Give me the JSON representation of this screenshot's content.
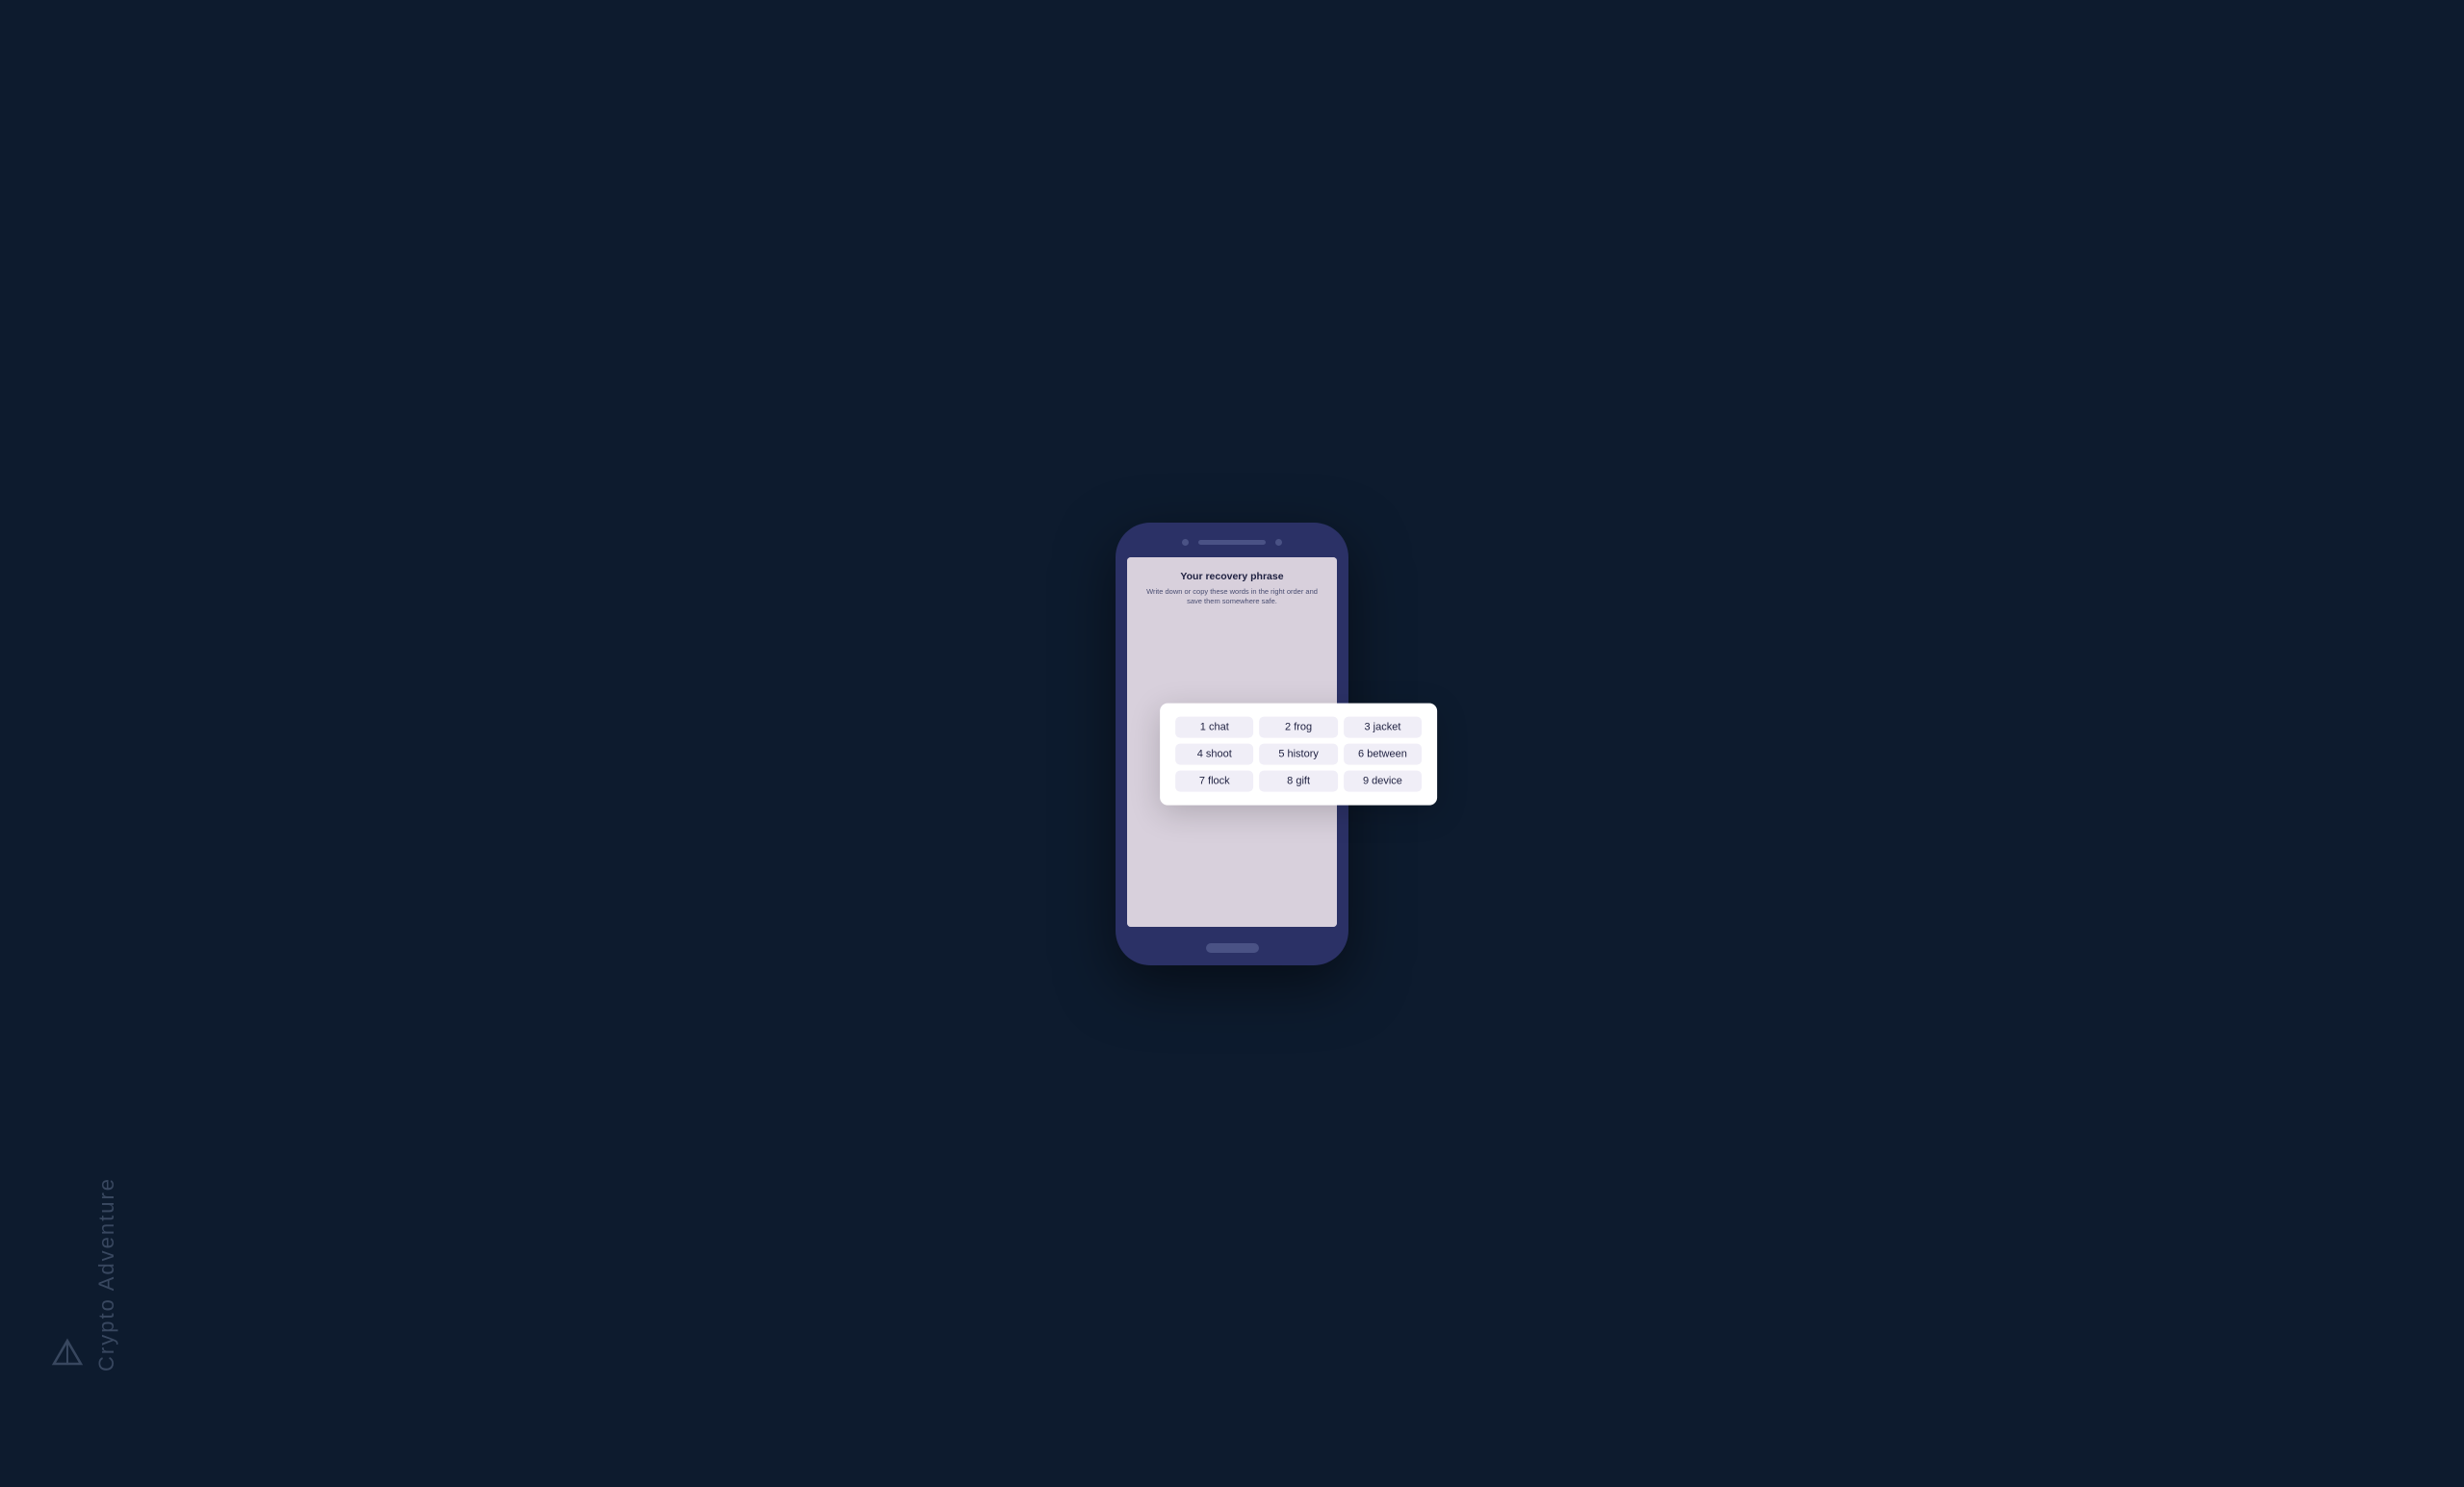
{
  "watermark": {
    "text": "Crypto Adventure",
    "icon_label": "crypto-adventure-logo"
  },
  "phone": {
    "screen": {
      "title": "Your recovery phrase",
      "subtitle": "Write down or copy these words in the right order and save them somewhere safe."
    }
  },
  "recovery_phrase": {
    "words": [
      {
        "number": "1",
        "word": "chat"
      },
      {
        "number": "2",
        "word": "frog"
      },
      {
        "number": "3",
        "word": "jacket"
      },
      {
        "number": "4",
        "word": "shoot"
      },
      {
        "number": "5",
        "word": "history"
      },
      {
        "number": "6",
        "word": "between"
      },
      {
        "number": "7",
        "word": "flock"
      },
      {
        "number": "8",
        "word": "gift"
      },
      {
        "number": "9",
        "word": "device"
      }
    ]
  },
  "colors": {
    "background": "#0d1b2e",
    "phone_body": "#2b3166",
    "screen_bg": "#d8d0dc",
    "card_bg": "#ffffff",
    "word_pill_bg": "#f0eef7",
    "title_color": "#1e2040",
    "subtitle_color": "#4a4e72"
  }
}
